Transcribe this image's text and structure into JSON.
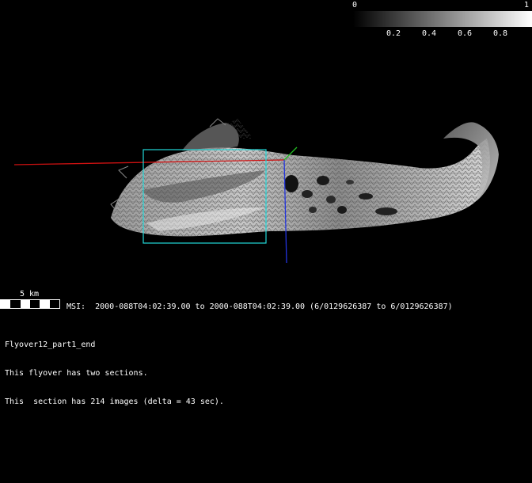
{
  "colorbar": {
    "min_label": "0",
    "max_label": "1",
    "tick_labels": [
      "0.2",
      "0.4",
      "0.6",
      "0.8"
    ]
  },
  "scale": {
    "label": "5 km"
  },
  "msi": {
    "text": "MSI:  2000-088T04:02:39.00 to 2000-088T04:02:39.00 (6/0129626387 to 6/0129626387)"
  },
  "info": {
    "lines": [
      "Flyover12_part1_end",
      "This flyover has two sections.",
      "This  section has 214 images (delta = 43 sec)."
    ]
  },
  "colors": {
    "background": "#000000",
    "x_axis": "#cc1111",
    "y_axis": "#2233dd",
    "z_axis": "#22bb22",
    "footprint_box": "#22d8d8"
  }
}
